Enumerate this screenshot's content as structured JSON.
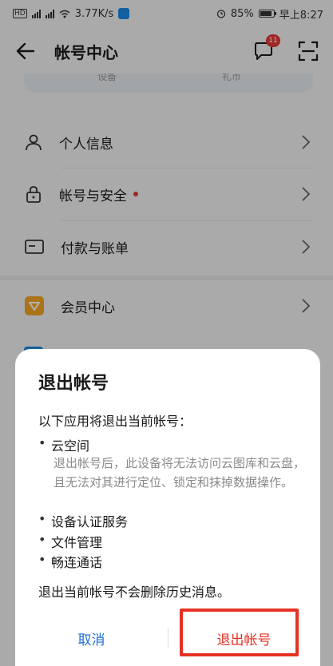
{
  "status_bar": {
    "network_speed": "3.77K/s",
    "battery": "85%",
    "time": "早上8:27",
    "hd_label": "HD"
  },
  "header": {
    "title": "帐号中心",
    "message_badge": "11"
  },
  "top_card": {
    "labels": [
      "设备",
      "礼币"
    ]
  },
  "list": {
    "items": [
      {
        "label": "个人信息",
        "icon": "person-icon"
      },
      {
        "label": "帐号与安全",
        "icon": "lock-icon",
        "has_red_dot": true
      },
      {
        "label": "付款与账单",
        "icon": "card-icon"
      },
      {
        "label": "会员中心",
        "icon": "vip-icon"
      }
    ]
  },
  "dialog": {
    "title": "退出帐号",
    "intro": "以下应用将退出当前帐号：",
    "services": [
      {
        "name": "云空间",
        "description": "退出帐号后，此设备将无法访问云图库和云盘，且无法对其进行定位、锁定和抹掉数据操作。"
      },
      {
        "name": "设备认证服务"
      },
      {
        "name": "文件管理"
      },
      {
        "name": "畅连通话"
      }
    ],
    "footer": "退出当前帐号不会删除历史消息。",
    "cancel_label": "取消",
    "confirm_label": "退出帐号"
  },
  "colors": {
    "accent_blue": "#1f6fd6",
    "highlight_red": "#e53224",
    "badge_red": "#e53935"
  }
}
